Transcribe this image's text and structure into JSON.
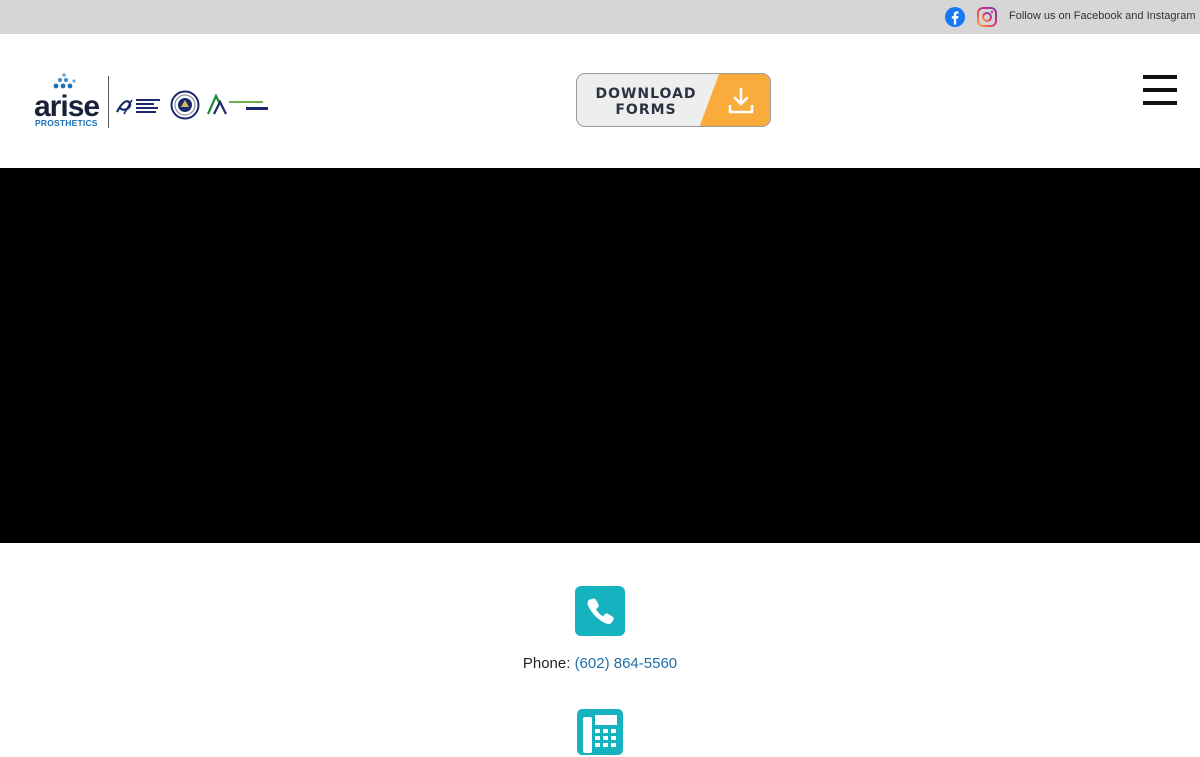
{
  "topbar": {
    "follow_text": "Follow us on Facebook and Instagram",
    "facebook_icon": "facebook-icon",
    "instagram_icon": "instagram-icon",
    "bg_color": "#d6d6d6"
  },
  "header": {
    "logo": {
      "brand": "arise",
      "sub": "PROSTHETICS"
    },
    "affiliate_logos": [
      "aopa-logo",
      "seal-logo",
      "academy-aaop-logo"
    ],
    "download": {
      "line1": "DOWNLOAD",
      "line2": "FORMS",
      "accent": "#f9ac3c"
    },
    "menu_icon": "hamburger-icon"
  },
  "video": {
    "bg_color": "#000000"
  },
  "contact": {
    "phone_label": "Phone:",
    "phone_number": "(602) 864-5560",
    "phone_icon": "phone-icon",
    "fax_icon": "fax-icon",
    "accent": "#15b3c0",
    "link_color": "#1f6fa8"
  }
}
